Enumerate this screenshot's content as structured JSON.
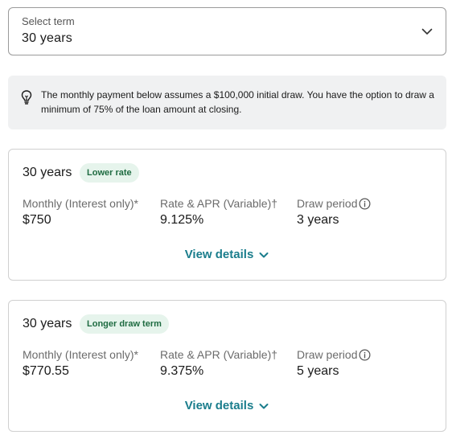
{
  "term_select": {
    "label": "Select term",
    "value": "30 years"
  },
  "info": {
    "text": "The monthly payment below assumes a $100,000 initial draw. You have the option to draw a minimum of 75% of the loan amount at closing."
  },
  "offers": [
    {
      "term": "30 years",
      "badge": "Lower rate",
      "monthly_label": "Monthly (Interest only)*",
      "monthly_value": "$750",
      "rate_label": "Rate & APR (Variable)†",
      "rate_value": "9.125%",
      "draw_label": "Draw period",
      "draw_value": "3 years",
      "details_label": "View details"
    },
    {
      "term": "30 years",
      "badge": "Longer draw term",
      "monthly_label": "Monthly (Interest only)*",
      "monthly_value": "$770.55",
      "rate_label": "Rate & APR (Variable)†",
      "rate_value": "9.375%",
      "draw_label": "Draw period",
      "draw_value": "5 years",
      "details_label": "View details"
    }
  ],
  "colors": {
    "accent": "#1a7d8c",
    "badge_bg": "#e6f4ec",
    "badge_text": "#1e6b41",
    "info_bg": "#f0f1f2"
  },
  "icons": {
    "select": "chevron-down-icon",
    "info_box": "lightbulb-icon",
    "draw_period": "info-icon",
    "details": "chevron-down-icon"
  }
}
